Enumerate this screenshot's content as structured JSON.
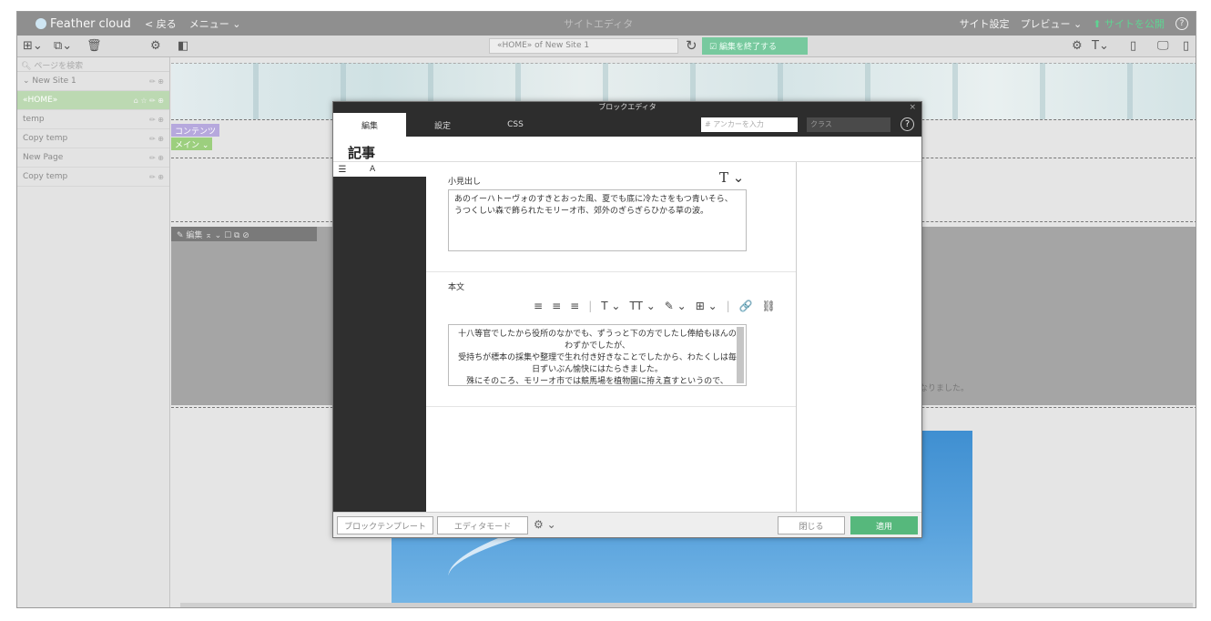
{
  "topbar": {
    "logo": "Feather cloud",
    "back": "< 戻る",
    "menu": "メニュー ⌄",
    "title": "サイトエディタ",
    "site_settings": "サイト設定",
    "preview": "プレビュー ⌄",
    "publish": "サイトを公開",
    "help": "?"
  },
  "toolbar2": {
    "url": "«HOME» of New Site 1",
    "finish_edit": "編集を終了する"
  },
  "sidebar": {
    "search_placeholder": "ページを検索",
    "items": [
      {
        "label": "⌄ New Site 1",
        "tools": "✏ ⊕"
      },
      {
        "label": "«HOME»",
        "tools": "⌂ ☆ ✏ ⊕"
      },
      {
        "label": "temp",
        "tools": "✏ ⊕"
      },
      {
        "label": "Copy temp",
        "tools": "✏ ⊕"
      },
      {
        "label": "New Page",
        "tools": "✏ ⊕"
      },
      {
        "label": "Copy temp",
        "tools": "✏ ⊕"
      }
    ]
  },
  "canvas": {
    "tag_content": "コンテンツ",
    "tag_main": "メイン ⌄",
    "edit_strip": "✎ 編集 ⌅ ⌄ ☐ ⧉ ⊘",
    "note": "なりました。"
  },
  "modal": {
    "title": "ブロックエディタ",
    "close_x": "×",
    "tabs": [
      "編集",
      "設定",
      "CSS"
    ],
    "anchor_placeholder": "# アンカーを入力",
    "class_placeholder": "クラス",
    "help": "?",
    "heading": "記事",
    "left_col": {
      "handle": "☰",
      "letter": "A"
    },
    "subheading_label": "小見出し",
    "font_button": "T ⌄",
    "subheading_lines": [
      "あのイーハトーヴォのすきとおった風、夏でも底に冷たさをもつ青いそら、",
      "うつくしい森で飾られたモリーオ市、郊外のぎらぎらひかる草の波。"
    ],
    "body_label": "本文",
    "rich_toolbar": [
      "≡",
      "≡",
      "≡",
      "T ⌄",
      "TT ⌄",
      "✎ ⌄",
      "⊞ ⌄",
      "🔗",
      "⛓"
    ],
    "body_lines": [
      "十八等官でしたから役所のなかでも、ずうっと下の方でしたし俸給もほんのわずかでしたが、",
      "受持ちが標本の採集や整理で生れ付き好きなことでしたから、わたくしは毎日ずいぶん愉快にはたらきました。",
      "殊にそのころ、モリーオ市では競馬場を植物園に拵え直すというので、"
    ],
    "footer": {
      "block_template": "ブロックテンプレート",
      "editor_mode": "エディタモード",
      "gear": "⚙ ⌄",
      "close": "閉じる",
      "apply": "適用"
    }
  }
}
